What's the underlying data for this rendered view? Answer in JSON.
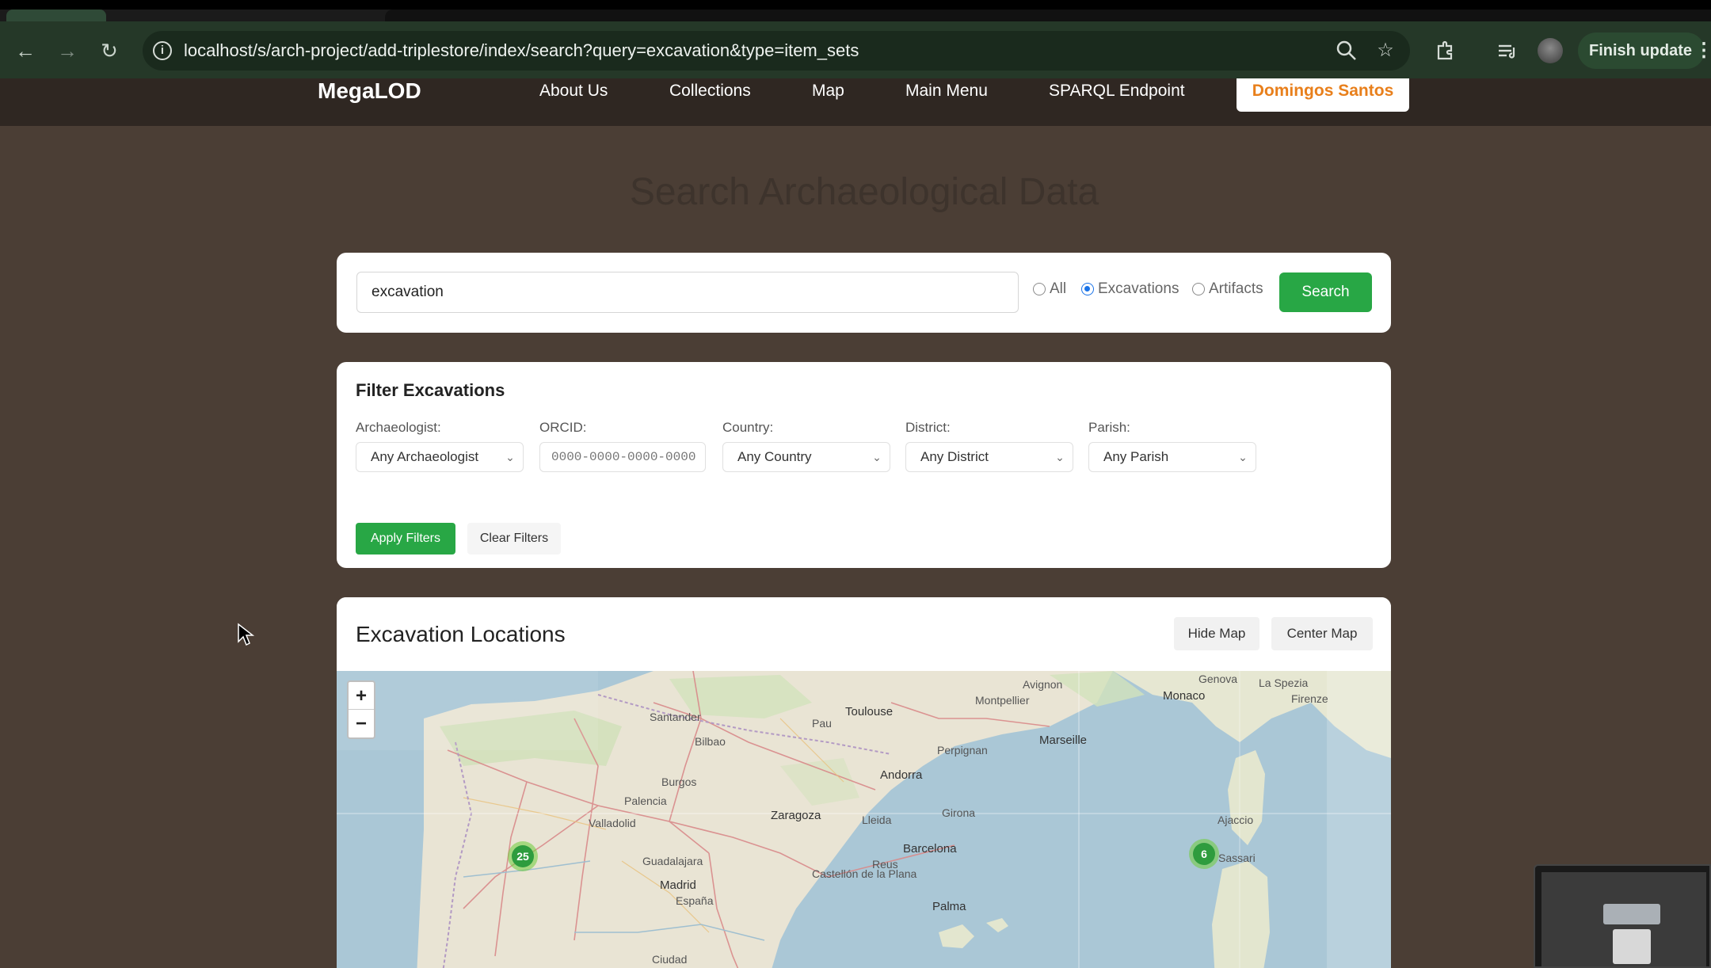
{
  "browser": {
    "url": "localhost/s/arch-project/add-triplestore/index/search?query=excavation&type=item_sets",
    "finish_update_label": "Finish update"
  },
  "site": {
    "brand": "MegaLOD",
    "nav": [
      "About Us",
      "Collections",
      "Map",
      "Main Menu",
      "SPARQL Endpoint"
    ],
    "user": "Domingos Santos"
  },
  "page": {
    "title": "Search Archaeological Data"
  },
  "search": {
    "query": "excavation",
    "types": [
      {
        "label": "All",
        "checked": false
      },
      {
        "label": "Excavations",
        "checked": true
      },
      {
        "label": "Artifacts",
        "checked": false
      }
    ],
    "button": "Search"
  },
  "filters": {
    "title": "Filter Excavations",
    "archaeologist": {
      "label": "Archaeologist:",
      "value": "Any Archaeologist"
    },
    "orcid": {
      "label": "ORCID:",
      "placeholder": "0000-0000-0000-0000"
    },
    "country": {
      "label": "Country:",
      "value": "Any Country"
    },
    "district": {
      "label": "District:",
      "value": "Any District"
    },
    "parish": {
      "label": "Parish:",
      "value": "Any Parish"
    },
    "apply": "Apply Filters",
    "clear": "Clear Filters"
  },
  "map": {
    "title": "Excavation Locations",
    "hide": "Hide Map",
    "center": "Center Map",
    "zoom_in": "+",
    "zoom_out": "−",
    "clusters": [
      "25",
      "6"
    ],
    "labels": [
      "Toulouse",
      "Marseille",
      "Andorra",
      "Zaragoza",
      "Barcelona",
      "Madrid",
      "Monaco",
      "Genova",
      "Palma",
      "Burgos",
      "Bilbao",
      "Palencia",
      "Valladolid",
      "Girona",
      "Lleida",
      "Guadalajara",
      "España",
      "Montpellier",
      "Avignon",
      "Firenze",
      "La Spezia",
      "Perpignan",
      "Castellón de la Plana",
      "Ciudad",
      "Sassari",
      "Ajaccio",
      "Santander",
      "Pau",
      "Reus"
    ]
  },
  "colors": {
    "accent_green": "#28a745",
    "user_orange": "#e87f1b",
    "site_bg": "#4b3e35",
    "nav_bg": "#2f2722"
  }
}
